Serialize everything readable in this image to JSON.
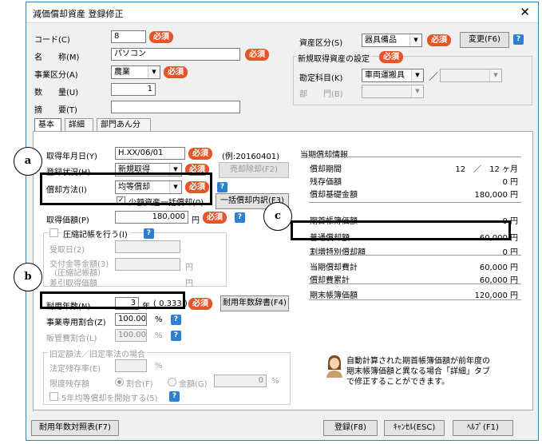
{
  "title": "減価償却資産 登録修正",
  "callouts": {
    "a": "a",
    "b": "b",
    "c": "c"
  },
  "required_badge": "必須",
  "help_glyph": "?",
  "top": {
    "code_label": "コード(C)",
    "code_value": "8",
    "name_label": "名　　称(M)",
    "name_value": "パソコン",
    "segment_label": "事業区分(A)",
    "segment_value": "農業",
    "qty_label": "数　　量(U)",
    "qty_value": "1",
    "summary_label": "摘　　要(T)",
    "summary_value": "",
    "asset_class_label": "資産区分(S)",
    "asset_class_value": "器具備品",
    "change_button": "変更(F6)",
    "new_asset_group": "新規取得資産の設定",
    "account_label": "勘定科目(K)",
    "account_value": "車両運搬具",
    "slash": "／",
    "dept_label": "部　　門(B)"
  },
  "tabs": [
    "基本",
    "詳細",
    "部門あん分"
  ],
  "basic": {
    "acq_date_label": "取得年月日(Y)",
    "acq_date_value": "H.XX/06/01",
    "acq_date_example": "(例:20160401)",
    "status_label": "登録状況(H)",
    "status_value": "新規取得",
    "retire_button": "売却除却(F2)",
    "method_label": "償却方法(I)",
    "method_value": "均等償却",
    "small_asset_label": "少額資産一括償却(0)",
    "small_asset_check": "✓",
    "lump_button": "一括償却内訳(F3)",
    "acq_price_label": "取得価額(P)",
    "acq_price_value": "180,000",
    "yen": "円",
    "compress_label": "圧縮記帳を行う(I)",
    "receive_date_label": "受取日(2)",
    "subsidy_label_1": "交付金等金額(3)",
    "subsidy_label_2": "（圧縮記帳額）",
    "diff_price_label": "差引取得価額",
    "life_label": "耐用年数(N)",
    "life_value": "3",
    "life_unit": "年",
    "life_rate": "( 0.333 )",
    "life_dict_button": "耐用年数辞書(F4)",
    "business_ratio_label": "事業専用割合(Z)",
    "business_ratio_value": "100.00",
    "percent": "%",
    "sales_ratio_label": "販管費割合(L)",
    "sales_ratio_value": "100.00",
    "old_method_group": "旧定額法／旧定率法の場合",
    "legal_residual_label": "法定残存率(E)",
    "legal_residual_value": "",
    "limit_residual_label": "限度残存額",
    "radio_ratio": "割合(F)",
    "radio_amount": "金額(G)",
    "residual_amount_value": "0",
    "five_year_label": "5年均等償却を開始する(5)"
  },
  "current_info": {
    "title": "当期償却情報",
    "rows": [
      {
        "label": "償却期間",
        "value": "12　／　12 ヶ月"
      },
      {
        "label": "残存価額",
        "value": "0 円"
      },
      {
        "label": "償却基礎金額",
        "value": "180,000 円"
      },
      {
        "label": "期首帳簿価額",
        "value": "0 円"
      },
      {
        "label": "普通償却額",
        "value": "60,000 円"
      },
      {
        "label": "割増特別償却額",
        "value": "0 円"
      },
      {
        "label": "当期償却費計",
        "value": "60,000 円"
      },
      {
        "label": "償却費累計",
        "value": "60,000 円"
      },
      {
        "label": "期末帳簿価額",
        "value": "120,000 円"
      }
    ]
  },
  "assistant_msg_1": "自動計算された期首帳簿価額が前年度の",
  "assistant_msg_2": "期末帳簿価額と異なる場合「詳細」タブ",
  "assistant_msg_3": "で修正することができます。",
  "footer": {
    "life_table_button": "耐用年数対照表(F7)",
    "register_button": "登録(F8)",
    "cancel_button": "ｷｬﾝｾﾙ(ESC)",
    "help_button": "ﾍﾙﾌﾟ(F1)"
  }
}
